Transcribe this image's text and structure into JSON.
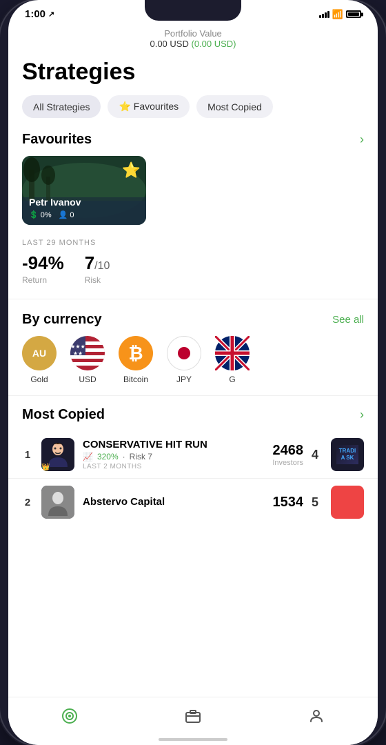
{
  "status": {
    "time": "1:00",
    "location_arrow": "⬆"
  },
  "portfolio": {
    "label": "Portfolio Value",
    "value_usd": "0.00 USD",
    "change_usd": "(0.00 USD)"
  },
  "page": {
    "title": "Strategies"
  },
  "filter_tabs": {
    "tab1": "All Strategies",
    "tab2": "⭐ Favourites",
    "tab3": "Most Copied"
  },
  "favourites": {
    "section_title": "Favourites",
    "trader": {
      "name": "Petr Ivanov",
      "return_pct": "0%",
      "followers": "0",
      "months_label": "LAST 29 MONTHS",
      "performance": "-94%",
      "performance_label": "Return",
      "risk": "7",
      "risk_max": "10",
      "risk_label": "Risk"
    }
  },
  "by_currency": {
    "section_title": "By currency",
    "see_all": "See all",
    "items": [
      {
        "id": "gold",
        "label": "Gold",
        "type": "gold"
      },
      {
        "id": "usd",
        "label": "USD",
        "type": "usd"
      },
      {
        "id": "btc",
        "label": "Bitcoin",
        "type": "btc"
      },
      {
        "id": "jpy",
        "label": "JPY",
        "type": "jpy"
      },
      {
        "id": "gbp",
        "label": "G",
        "type": "gbp"
      }
    ]
  },
  "most_copied": {
    "section_title": "Most Copied",
    "items": [
      {
        "rank": "1",
        "name": "CONSERVATIVE HIT RUN",
        "return_pct": "320%",
        "risk": "7",
        "months_label": "LAST 2 MONTHS",
        "investors": "2468",
        "investors_label": "Investors",
        "position": "4"
      },
      {
        "rank": "2",
        "name": "Abstervo Capital",
        "return_pct": "",
        "risk": "",
        "months_label": "",
        "investors": "1534",
        "investors_label": "",
        "position": "5"
      }
    ]
  },
  "bottom_nav": {
    "item1_icon": "◎",
    "item2_icon": "▬",
    "item3_icon": "👤"
  }
}
